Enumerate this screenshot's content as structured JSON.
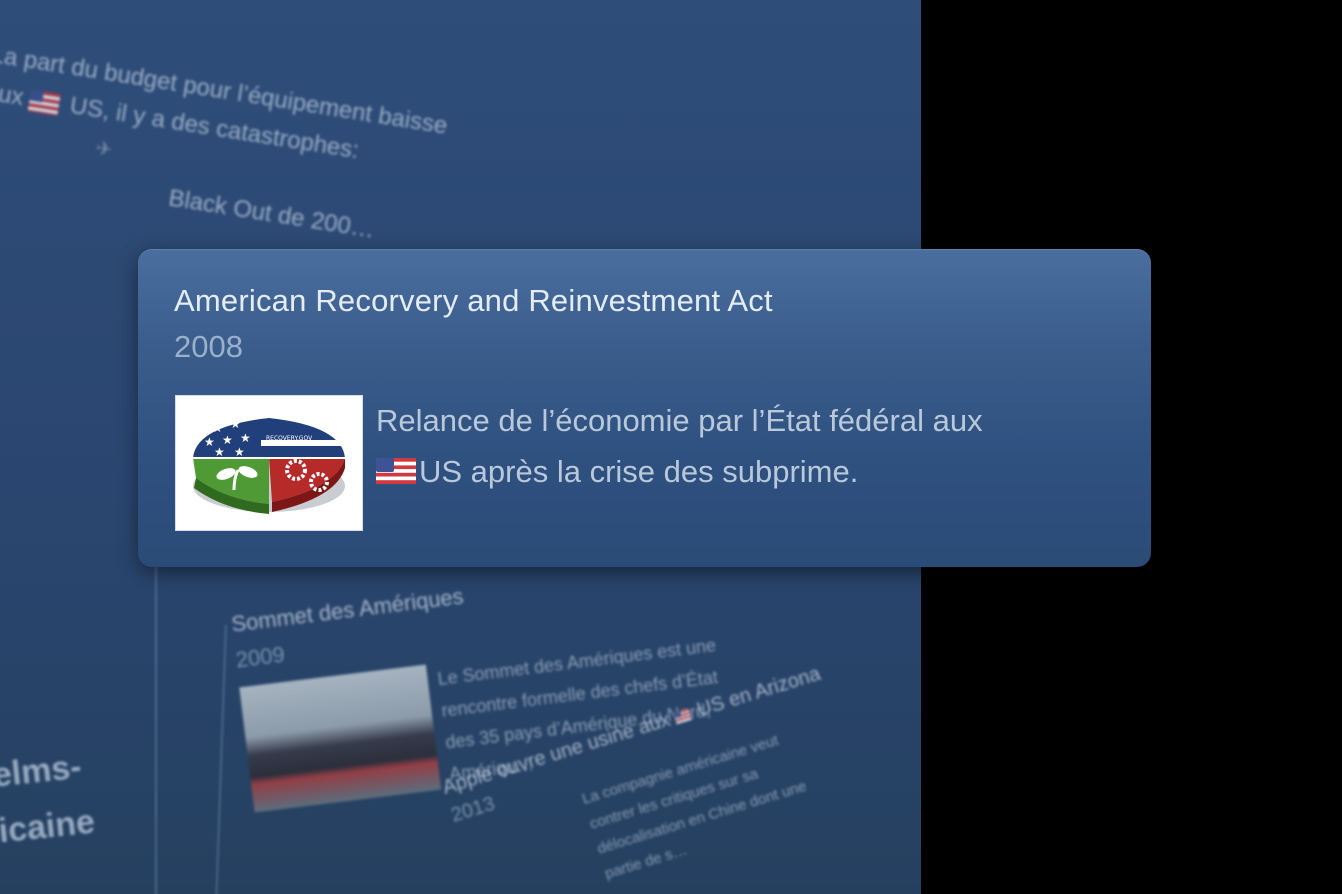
{
  "background": {
    "top_fragment": {
      "line1": "La part du budget pour l’équipement baisse",
      "line2_prefix": "aux ",
      "line2_rest": "US, il y a des catastrophes:",
      "line4": "Black Out de 200…"
    },
    "left_fragment": {
      "line1": "elms-",
      "line2": "icaine"
    },
    "sommet": {
      "title": "Sommet des Amériques",
      "year": "2009",
      "description": "Le Sommet des Amériques est une rencontre formelle des chefs d’État des 35 pays d’Amérique du Nord, Amériqu…"
    },
    "apple": {
      "title_prefix": "Apple ouvre une usine aux ",
      "title_rest": "US en Arizona",
      "year": "2013",
      "description": "La compagnie américaine veut contrer les critiques sur sa délocalisation en Chine dont une partie de s…"
    }
  },
  "card": {
    "title": "American Recorvery and Reinvestment Act",
    "year": "2008",
    "thumbnail_alt": "RECOVERY.GOV",
    "description_line1": "Relance de l’économie par l’État fédéral aux",
    "description_line2": "US après la crise des subprime."
  },
  "icons": {
    "flag": "us-flag-icon",
    "thumbnail": "recovery-gov-logo"
  },
  "colors": {
    "panel_bg": "#2e4d79",
    "card_bg": "#3a5d8c",
    "title_text": "#e4ecf5",
    "year_text": "#9ab0cb",
    "desc_text": "#b9c8da"
  }
}
